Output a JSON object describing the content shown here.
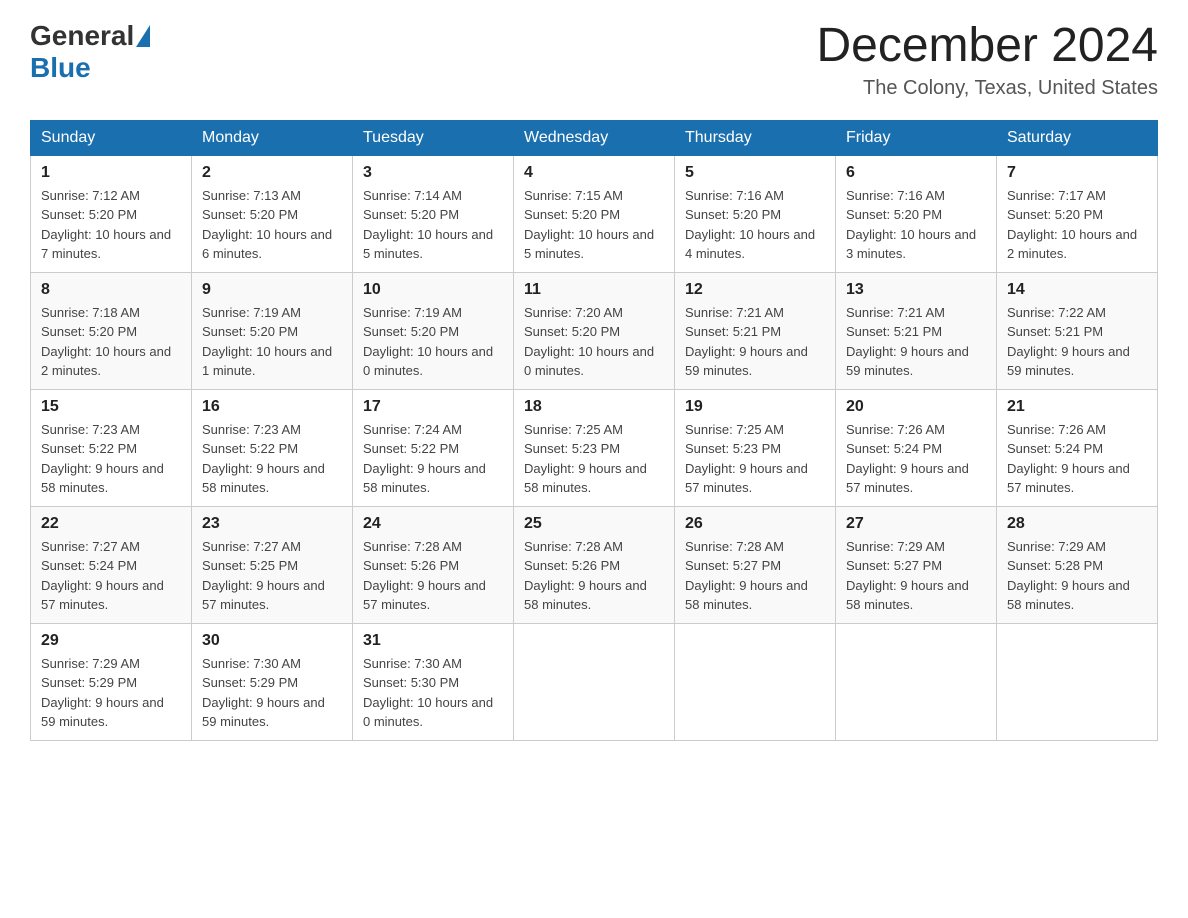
{
  "header": {
    "logo_general": "General",
    "logo_blue": "Blue",
    "month_year": "December 2024",
    "location": "The Colony, Texas, United States"
  },
  "days_of_week": [
    "Sunday",
    "Monday",
    "Tuesday",
    "Wednesday",
    "Thursday",
    "Friday",
    "Saturday"
  ],
  "weeks": [
    [
      {
        "day": "1",
        "sunrise": "7:12 AM",
        "sunset": "5:20 PM",
        "daylight": "10 hours and 7 minutes."
      },
      {
        "day": "2",
        "sunrise": "7:13 AM",
        "sunset": "5:20 PM",
        "daylight": "10 hours and 6 minutes."
      },
      {
        "day": "3",
        "sunrise": "7:14 AM",
        "sunset": "5:20 PM",
        "daylight": "10 hours and 5 minutes."
      },
      {
        "day": "4",
        "sunrise": "7:15 AM",
        "sunset": "5:20 PM",
        "daylight": "10 hours and 5 minutes."
      },
      {
        "day": "5",
        "sunrise": "7:16 AM",
        "sunset": "5:20 PM",
        "daylight": "10 hours and 4 minutes."
      },
      {
        "day": "6",
        "sunrise": "7:16 AM",
        "sunset": "5:20 PM",
        "daylight": "10 hours and 3 minutes."
      },
      {
        "day": "7",
        "sunrise": "7:17 AM",
        "sunset": "5:20 PM",
        "daylight": "10 hours and 2 minutes."
      }
    ],
    [
      {
        "day": "8",
        "sunrise": "7:18 AM",
        "sunset": "5:20 PM",
        "daylight": "10 hours and 2 minutes."
      },
      {
        "day": "9",
        "sunrise": "7:19 AM",
        "sunset": "5:20 PM",
        "daylight": "10 hours and 1 minute."
      },
      {
        "day": "10",
        "sunrise": "7:19 AM",
        "sunset": "5:20 PM",
        "daylight": "10 hours and 0 minutes."
      },
      {
        "day": "11",
        "sunrise": "7:20 AM",
        "sunset": "5:20 PM",
        "daylight": "10 hours and 0 minutes."
      },
      {
        "day": "12",
        "sunrise": "7:21 AM",
        "sunset": "5:21 PM",
        "daylight": "9 hours and 59 minutes."
      },
      {
        "day": "13",
        "sunrise": "7:21 AM",
        "sunset": "5:21 PM",
        "daylight": "9 hours and 59 minutes."
      },
      {
        "day": "14",
        "sunrise": "7:22 AM",
        "sunset": "5:21 PM",
        "daylight": "9 hours and 59 minutes."
      }
    ],
    [
      {
        "day": "15",
        "sunrise": "7:23 AM",
        "sunset": "5:22 PM",
        "daylight": "9 hours and 58 minutes."
      },
      {
        "day": "16",
        "sunrise": "7:23 AM",
        "sunset": "5:22 PM",
        "daylight": "9 hours and 58 minutes."
      },
      {
        "day": "17",
        "sunrise": "7:24 AM",
        "sunset": "5:22 PM",
        "daylight": "9 hours and 58 minutes."
      },
      {
        "day": "18",
        "sunrise": "7:25 AM",
        "sunset": "5:23 PM",
        "daylight": "9 hours and 58 minutes."
      },
      {
        "day": "19",
        "sunrise": "7:25 AM",
        "sunset": "5:23 PM",
        "daylight": "9 hours and 57 minutes."
      },
      {
        "day": "20",
        "sunrise": "7:26 AM",
        "sunset": "5:24 PM",
        "daylight": "9 hours and 57 minutes."
      },
      {
        "day": "21",
        "sunrise": "7:26 AM",
        "sunset": "5:24 PM",
        "daylight": "9 hours and 57 minutes."
      }
    ],
    [
      {
        "day": "22",
        "sunrise": "7:27 AM",
        "sunset": "5:24 PM",
        "daylight": "9 hours and 57 minutes."
      },
      {
        "day": "23",
        "sunrise": "7:27 AM",
        "sunset": "5:25 PM",
        "daylight": "9 hours and 57 minutes."
      },
      {
        "day": "24",
        "sunrise": "7:28 AM",
        "sunset": "5:26 PM",
        "daylight": "9 hours and 57 minutes."
      },
      {
        "day": "25",
        "sunrise": "7:28 AM",
        "sunset": "5:26 PM",
        "daylight": "9 hours and 58 minutes."
      },
      {
        "day": "26",
        "sunrise": "7:28 AM",
        "sunset": "5:27 PM",
        "daylight": "9 hours and 58 minutes."
      },
      {
        "day": "27",
        "sunrise": "7:29 AM",
        "sunset": "5:27 PM",
        "daylight": "9 hours and 58 minutes."
      },
      {
        "day": "28",
        "sunrise": "7:29 AM",
        "sunset": "5:28 PM",
        "daylight": "9 hours and 58 minutes."
      }
    ],
    [
      {
        "day": "29",
        "sunrise": "7:29 AM",
        "sunset": "5:29 PM",
        "daylight": "9 hours and 59 minutes."
      },
      {
        "day": "30",
        "sunrise": "7:30 AM",
        "sunset": "5:29 PM",
        "daylight": "9 hours and 59 minutes."
      },
      {
        "day": "31",
        "sunrise": "7:30 AM",
        "sunset": "5:30 PM",
        "daylight": "10 hours and 0 minutes."
      },
      null,
      null,
      null,
      null
    ]
  ],
  "labels": {
    "sunrise": "Sunrise:",
    "sunset": "Sunset:",
    "daylight": "Daylight:"
  }
}
